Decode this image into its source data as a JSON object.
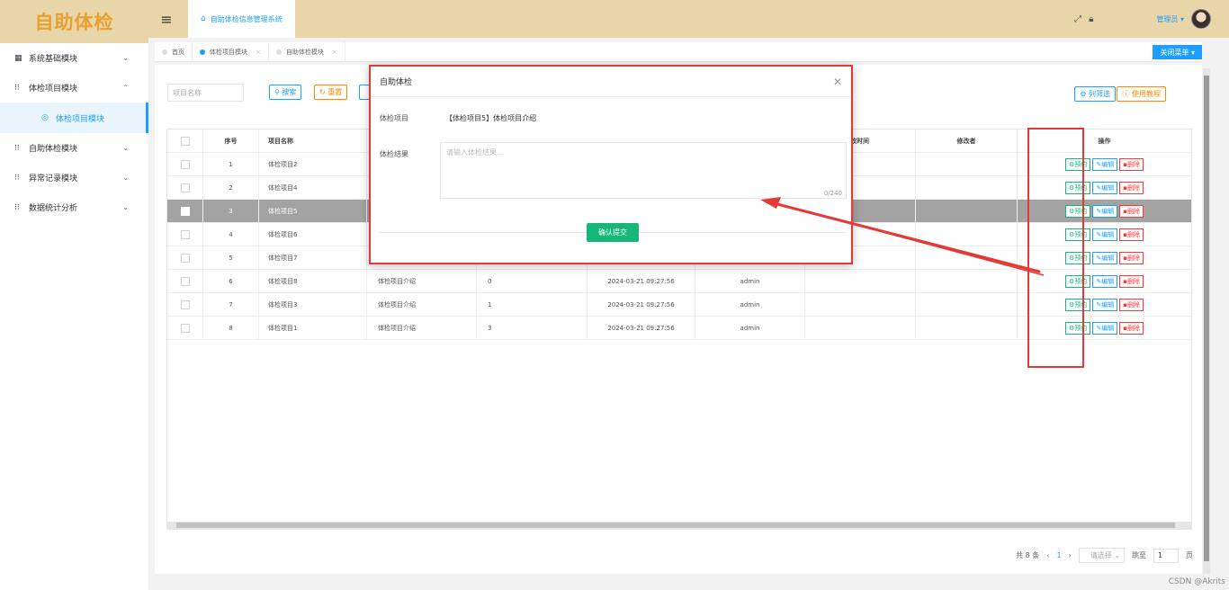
{
  "app": {
    "logo": "自助体检",
    "system_title": "自助体检信息管理系统"
  },
  "sidebar": {
    "items": [
      {
        "label": "系统基础模块",
        "icon": "grid-icon"
      },
      {
        "label": "体检项目模块",
        "icon": "grid-icon"
      },
      {
        "label": "体检项目模块",
        "icon": "sub-item-icon"
      },
      {
        "label": "自助体检模块",
        "icon": "grid-icon"
      },
      {
        "label": "异常记录模块",
        "icon": "grid-icon"
      },
      {
        "label": "数据统计分析",
        "icon": "grid-icon"
      }
    ]
  },
  "header": {
    "admin_label": "管理员"
  },
  "tabs": [
    {
      "label": "首页"
    },
    {
      "label": "体检项目模块"
    },
    {
      "label": "自助体检模块"
    }
  ],
  "close_menu_label": "关闭菜单",
  "toolbar": {
    "search_placeholder": "项目名称",
    "search_label": "搜索",
    "reset_label": "重置",
    "columns_label": "列筛选",
    "help_label": "使用教程"
  },
  "table": {
    "headers": {
      "no": "序号",
      "name": "项目名称",
      "mod_time": "改时间",
      "mod_by": "修改者",
      "op": "操作"
    },
    "ops": {
      "book": "预约",
      "edit": "编辑",
      "del": "删除"
    },
    "rows": [
      {
        "no": "1",
        "name": "体检项目2",
        "desc": "",
        "num": "",
        "time": "",
        "by": ""
      },
      {
        "no": "2",
        "name": "体检项目4",
        "desc": "",
        "num": "",
        "time": "",
        "by": ""
      },
      {
        "no": "3",
        "name": "体检项目5",
        "desc": "",
        "num": "",
        "time": "",
        "by": ""
      },
      {
        "no": "4",
        "name": "体检项目6",
        "desc": "",
        "num": "",
        "time": "",
        "by": ""
      },
      {
        "no": "5",
        "name": "体检项目7",
        "desc": "",
        "num": "",
        "time": "",
        "by": ""
      },
      {
        "no": "6",
        "name": "体检项目8",
        "desc": "体检项目介绍",
        "num": "0",
        "time": "2024-03-21 09:27:56",
        "by": "admin"
      },
      {
        "no": "7",
        "name": "体检项目3",
        "desc": "体检项目介绍",
        "num": "1",
        "time": "2024-03-21 09:27:56",
        "by": "admin"
      },
      {
        "no": "8",
        "name": "体检项目1",
        "desc": "体检项目介绍",
        "num": "3",
        "time": "2024-03-21 09:27:56",
        "by": "admin"
      }
    ]
  },
  "pager": {
    "total": "共 8 条",
    "current": "1",
    "select": "请选择",
    "goto": "跳至",
    "page_input": "1",
    "page_suffix": "页"
  },
  "modal": {
    "title": "自助体检",
    "item_label": "体检项目",
    "item_value": "【体检项目5】体检项目介绍",
    "result_label": "体检结果",
    "result_placeholder": "请输入体检结果...",
    "char_count": "0/240",
    "submit_label": "确认提交"
  },
  "watermark": "CSDN @Akrits"
}
